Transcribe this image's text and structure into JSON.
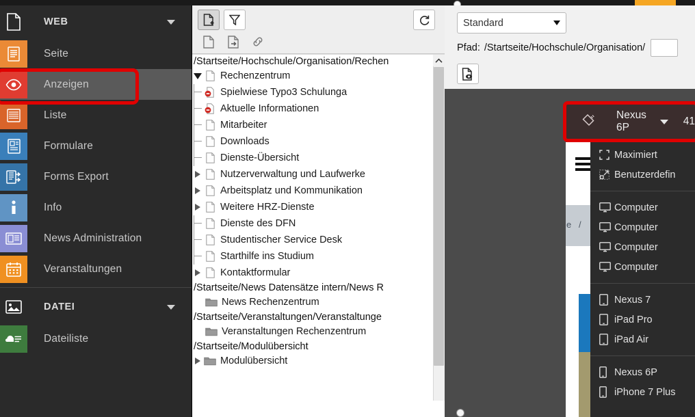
{
  "topbar": {
    "accent_color": "#f5a623"
  },
  "sidebar": {
    "sections": [
      {
        "name": "WEB",
        "label": "WEB",
        "icon": "page-icon",
        "has_caret": true,
        "items": [
          {
            "label": "Seite",
            "icon": "page-module-icon",
            "color": "#eb8a36",
            "active": false
          },
          {
            "label": "Anzeigen",
            "icon": "eye-icon",
            "color": "#e03c31",
            "active": true,
            "highlighted": true
          },
          {
            "label": "Liste",
            "icon": "list-icon",
            "color": "#d9642a",
            "active": false
          },
          {
            "label": "Formulare",
            "icon": "form-icon",
            "color": "#3a7fba",
            "active": false
          },
          {
            "label": "Forms Export",
            "icon": "forms-export-icon",
            "color": "#3574a8",
            "active": false
          },
          {
            "label": "Info",
            "icon": "info-icon",
            "color": "#6094c4",
            "active": false
          },
          {
            "label": "News Administration",
            "icon": "newspaper-icon",
            "color": "#8a8ed4",
            "active": false
          },
          {
            "label": "Veranstaltungen",
            "icon": "calendar-icon",
            "color": "#f09021",
            "active": false
          }
        ]
      },
      {
        "name": "DATEI",
        "label": "DATEI",
        "icon": "image-icon",
        "has_caret": true,
        "items": [
          {
            "label": "Dateiliste",
            "icon": "filelist-icon",
            "color": "#3e7c3e",
            "active": false
          }
        ]
      }
    ]
  },
  "tree_panel": {
    "toolbar": {
      "new_page_button": "new-page-icon",
      "filter_button": "filter-icon",
      "refresh_button": "refresh-icon",
      "drag_page_button": "blank-page-icon",
      "drag_shortcut_button": "page-arrow-icon",
      "drag_link_button": "link-icon"
    },
    "scrollbar": {
      "up_arrow": "chevron-up-icon"
    },
    "nodes": [
      {
        "type": "path",
        "label": "/Startseite/Hochschule/Organisation/Rechen"
      },
      {
        "type": "page",
        "label": "Rechenzentrum",
        "depth": 0,
        "toggle": "down",
        "icon": "page-icon",
        "selected": true
      },
      {
        "type": "page",
        "label": "Spielwiese Typo3 Schulunga",
        "depth": 1,
        "toggle": "line",
        "icon": "page-hidden-icon"
      },
      {
        "type": "page",
        "label": "Aktuelle Informationen",
        "depth": 1,
        "toggle": "line",
        "icon": "page-hidden-icon"
      },
      {
        "type": "page",
        "label": "Mitarbeiter",
        "depth": 1,
        "toggle": "line",
        "icon": "page-icon"
      },
      {
        "type": "page",
        "label": "Downloads",
        "depth": 1,
        "toggle": "line",
        "icon": "page-icon"
      },
      {
        "type": "page",
        "label": "Dienste-Übersicht",
        "depth": 1,
        "toggle": "line",
        "icon": "page-icon"
      },
      {
        "type": "page",
        "label": "Nutzerverwaltung und Laufwerke",
        "depth": 1,
        "toggle": "right",
        "icon": "page-icon"
      },
      {
        "type": "page",
        "label": "Arbeitsplatz und Kommunikation",
        "depth": 1,
        "toggle": "right",
        "icon": "page-icon"
      },
      {
        "type": "page",
        "label": "Weitere HRZ-Dienste",
        "depth": 1,
        "toggle": "right",
        "icon": "page-icon"
      },
      {
        "type": "page",
        "label": "Dienste des DFN",
        "depth": 1,
        "toggle": "line",
        "icon": "page-icon"
      },
      {
        "type": "page",
        "label": "Studentischer Service Desk",
        "depth": 1,
        "toggle": "line",
        "icon": "page-icon"
      },
      {
        "type": "page",
        "label": "Starthilfe ins Studium",
        "depth": 1,
        "toggle": "line",
        "icon": "page-icon"
      },
      {
        "type": "page",
        "label": "Kontaktformular",
        "depth": 1,
        "toggle": "right",
        "icon": "page-icon"
      },
      {
        "type": "path",
        "label": "/Startseite/News Datensätze intern/News R"
      },
      {
        "type": "folder",
        "label": "News Rechenzentrum",
        "depth": 0,
        "toggle": "none",
        "icon": "folder-icon"
      },
      {
        "type": "path",
        "label": "/Startseite/Veranstaltungen/Veranstaltunge"
      },
      {
        "type": "folder",
        "label": "Veranstaltungen Rechenzentrum",
        "depth": 0,
        "toggle": "none",
        "icon": "folder-icon"
      },
      {
        "type": "path",
        "label": "/Startseite/Modulübersicht"
      },
      {
        "type": "folder",
        "label": "Modulübersicht",
        "depth": 0,
        "toggle": "right",
        "icon": "folder-icon"
      }
    ]
  },
  "content": {
    "view_select": {
      "value": "Standard",
      "caret": "chevron-down-icon"
    },
    "path_label": "Pfad:",
    "path_value": "/Startseite/Hochschule/Organisation/",
    "preview_button": "page-preview-icon",
    "resize_handle": "resize-dot"
  },
  "preview": {
    "menu_icon": "hamburger-icon",
    "breadcrumb_part_1": "e",
    "breadcrumb_part_2": "/"
  },
  "device_bar": {
    "rotate_icon": "rotate-device-icon",
    "device_name": "Nexus 6P",
    "caret": "chevron-down-icon",
    "width_value": "41"
  },
  "device_menu": {
    "groups": [
      {
        "items": [
          {
            "label": "Maximiert",
            "icon": "maximize-icon"
          },
          {
            "label": "Benutzerdefin",
            "icon": "custom-size-icon"
          }
        ]
      },
      {
        "items": [
          {
            "label": "Computer",
            "icon": "desktop-icon"
          },
          {
            "label": "Computer",
            "icon": "desktop-icon"
          },
          {
            "label": "Computer",
            "icon": "desktop-icon"
          },
          {
            "label": "Computer",
            "icon": "desktop-icon"
          }
        ]
      },
      {
        "items": [
          {
            "label": "Nexus 7",
            "icon": "tablet-icon"
          },
          {
            "label": "iPad Pro",
            "icon": "tablet-icon"
          },
          {
            "label": "iPad Air",
            "icon": "tablet-icon"
          }
        ]
      },
      {
        "items": [
          {
            "label": "Nexus 6P",
            "icon": "phone-icon"
          },
          {
            "label": "iPhone 7 Plus",
            "icon": "phone-icon"
          }
        ]
      }
    ]
  },
  "highlights": {
    "color": "#e00000"
  }
}
